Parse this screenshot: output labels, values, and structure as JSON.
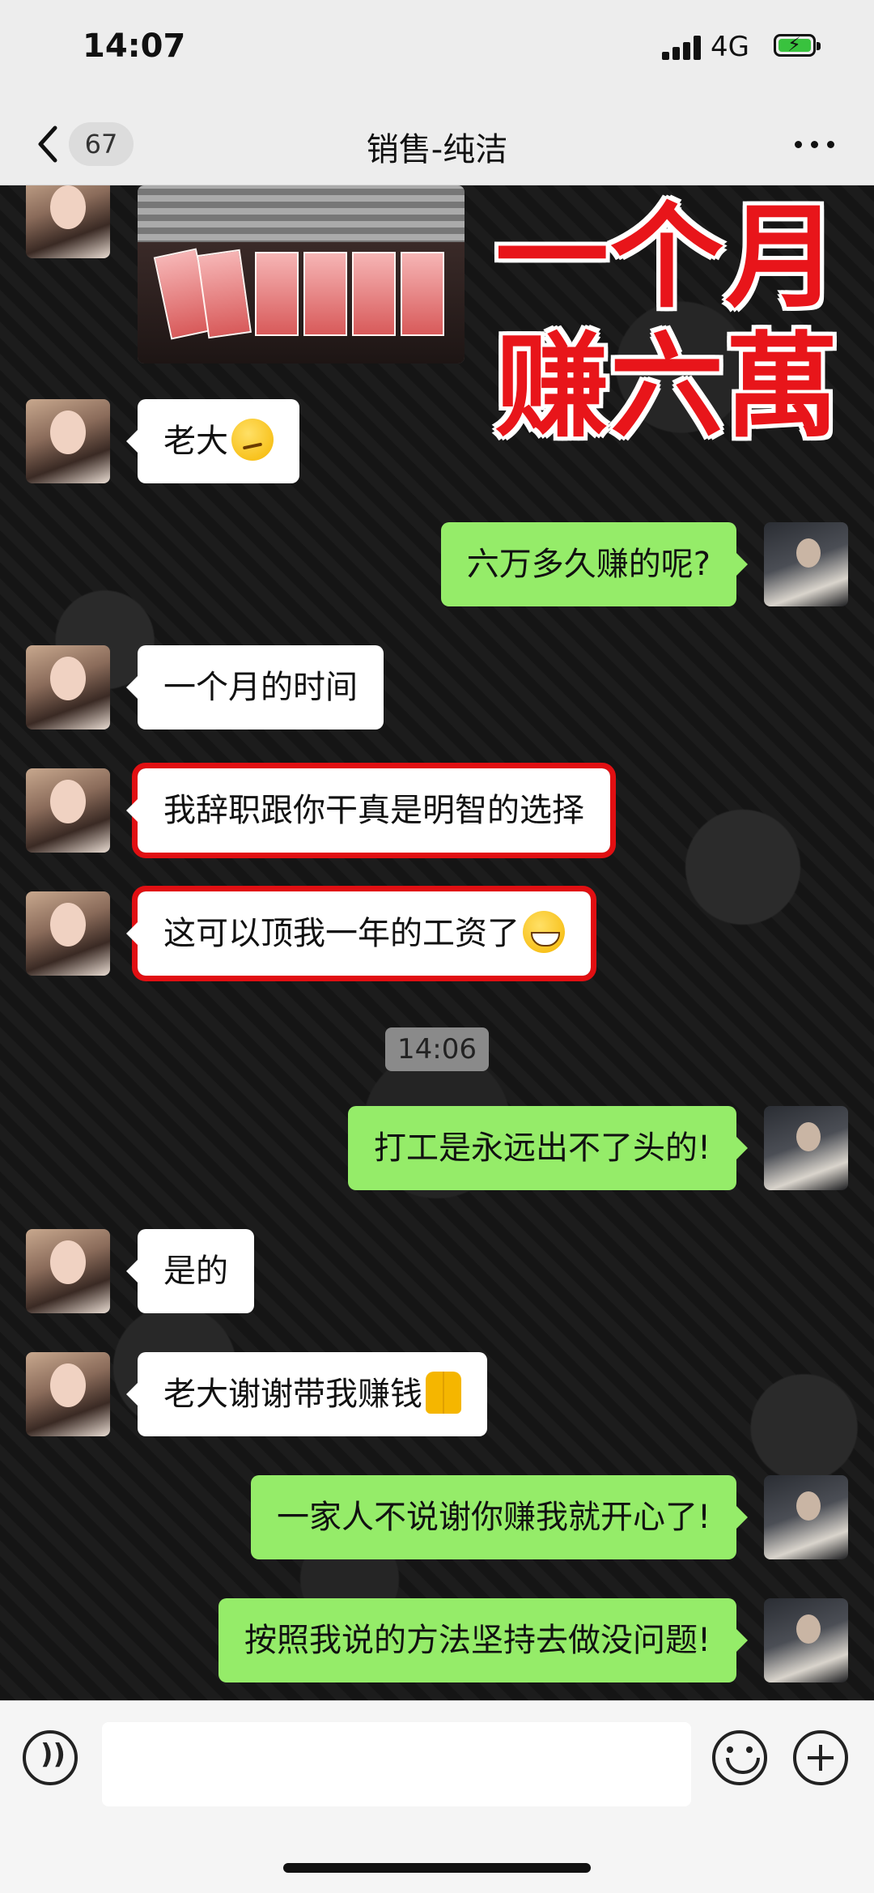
{
  "status_bar": {
    "time": "14:07",
    "network": "4G",
    "battery_charging": true
  },
  "header": {
    "back_badge": "67",
    "title": "销售-纯洁",
    "more_icon": "more-dots-icon",
    "back_icon": "chevron-left-icon"
  },
  "overlay": {
    "line1": "一个月",
    "line2": "赚六萬",
    "color": "#e8151a"
  },
  "messages": [
    {
      "from": "her",
      "text": "老大",
      "emoji": "smirk-emoji"
    },
    {
      "from": "me",
      "text": "六万多久赚的呢?"
    },
    {
      "from": "her",
      "text": "一个月的时间"
    },
    {
      "from": "her",
      "text": "我辞职跟你干真是明智的选择",
      "highlighted": true
    },
    {
      "from": "her",
      "text": "这可以顶我一年的工资了",
      "emoji": "grin-emoji",
      "highlighted": true
    },
    {
      "from": "me",
      "text": "打工是永远出不了头的!"
    },
    {
      "from": "her",
      "text": "是的"
    },
    {
      "from": "her",
      "text": "老大谢谢带我赚钱",
      "emoji": "pray-emoji"
    },
    {
      "from": "me",
      "text": "一家人不说谢你赚我就开心了!"
    },
    {
      "from": "me",
      "text": "按照我说的方法坚持去做没问题!"
    }
  ],
  "timestamp_chip": "14:06",
  "colors": {
    "my_bubble": "#95ec69",
    "her_bubble": "#ffffff",
    "highlight_border": "#e10f12"
  },
  "input_bar": {
    "voice_icon": "voice-icon",
    "emoji_icon": "emoji-icon",
    "plus_icon": "plus-icon"
  }
}
